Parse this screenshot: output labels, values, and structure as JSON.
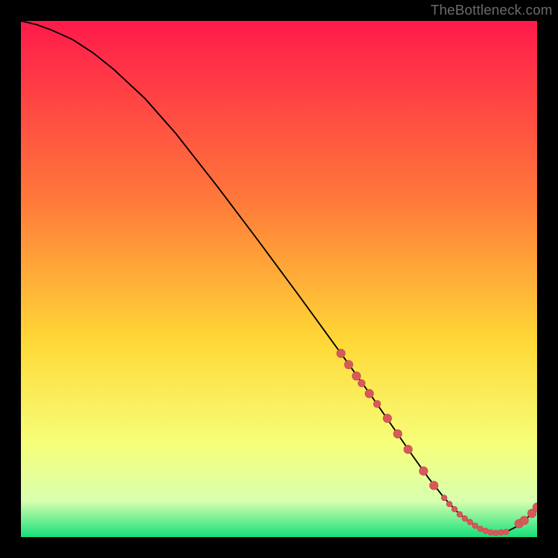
{
  "watermark": "TheBottleneck.com",
  "colors": {
    "gradient_top": "#ff1a4b",
    "gradient_mid1": "#ff7a3a",
    "gradient_mid2": "#ffd836",
    "gradient_mid3": "#f6ff7a",
    "gradient_mid4": "#d9ffb0",
    "gradient_bottom": "#16e07a",
    "curve": "#000000",
    "marker_fill": "#d65a5a",
    "marker_stroke": "#c94f4f"
  },
  "chart_data": {
    "type": "line",
    "title": "",
    "xlabel": "",
    "ylabel": "",
    "xlim": [
      0,
      100
    ],
    "ylim": [
      0,
      100
    ],
    "curve": {
      "x": [
        0,
        3,
        6,
        10,
        14,
        18,
        24,
        30,
        38,
        46,
        54,
        62,
        68,
        72,
        76,
        79,
        82,
        85,
        88,
        90,
        92,
        94,
        96,
        98,
        100
      ],
      "y": [
        100,
        99.3,
        98.2,
        96.4,
        93.8,
        90.6,
        85.0,
        78.2,
        68.0,
        57.4,
        46.6,
        35.6,
        27.2,
        21.4,
        15.6,
        11.4,
        7.6,
        4.4,
        2.2,
        1.2,
        0.8,
        1.0,
        2.0,
        3.6,
        5.8
      ]
    },
    "markers": [
      {
        "x": 62,
        "y": 35.6,
        "r": 6
      },
      {
        "x": 63.5,
        "y": 33.4,
        "r": 6
      },
      {
        "x": 65,
        "y": 31.2,
        "r": 6
      },
      {
        "x": 66,
        "y": 29.8,
        "r": 5
      },
      {
        "x": 67.5,
        "y": 27.8,
        "r": 6
      },
      {
        "x": 69,
        "y": 25.8,
        "r": 5
      },
      {
        "x": 71,
        "y": 23.0,
        "r": 6
      },
      {
        "x": 73,
        "y": 20.0,
        "r": 6
      },
      {
        "x": 75,
        "y": 17.0,
        "r": 6
      },
      {
        "x": 78,
        "y": 12.8,
        "r": 6
      },
      {
        "x": 80,
        "y": 10.0,
        "r": 6
      },
      {
        "x": 82,
        "y": 7.6,
        "r": 4
      },
      {
        "x": 83,
        "y": 6.4,
        "r": 4
      },
      {
        "x": 84,
        "y": 5.4,
        "r": 4
      },
      {
        "x": 85,
        "y": 4.4,
        "r": 4
      },
      {
        "x": 86,
        "y": 3.6,
        "r": 4
      },
      {
        "x": 87,
        "y": 2.9,
        "r": 4
      },
      {
        "x": 88,
        "y": 2.2,
        "r": 4
      },
      {
        "x": 89,
        "y": 1.6,
        "r": 4
      },
      {
        "x": 90,
        "y": 1.2,
        "r": 4
      },
      {
        "x": 91,
        "y": 0.9,
        "r": 4
      },
      {
        "x": 92,
        "y": 0.8,
        "r": 4
      },
      {
        "x": 93,
        "y": 0.9,
        "r": 4
      },
      {
        "x": 94,
        "y": 1.0,
        "r": 4
      },
      {
        "x": 96.5,
        "y": 2.6,
        "r": 6
      },
      {
        "x": 97.5,
        "y": 3.2,
        "r": 6
      },
      {
        "x": 99,
        "y": 4.6,
        "r": 6
      },
      {
        "x": 100,
        "y": 5.8,
        "r": 6
      }
    ]
  }
}
